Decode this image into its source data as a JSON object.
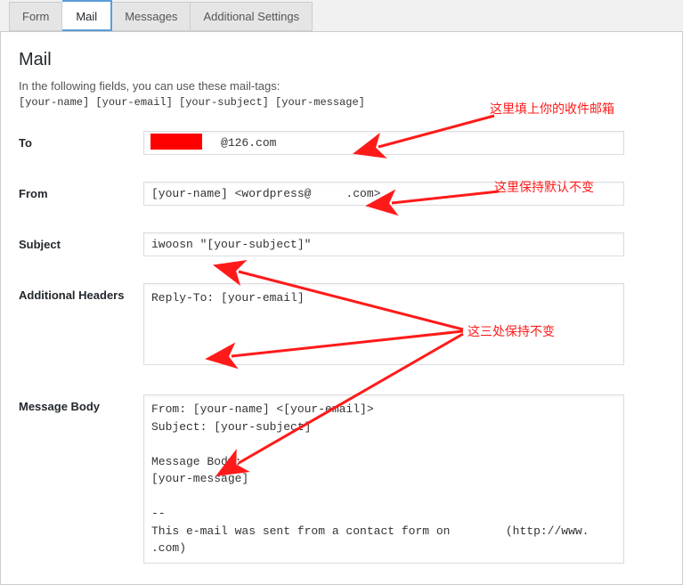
{
  "tabs": {
    "form": "Form",
    "mail": "Mail",
    "messages": "Messages",
    "additional": "Additional Settings"
  },
  "heading": "Mail",
  "intro": "In the following fields, you can use these mail-tags:",
  "mailtags": "[your-name] [your-email] [your-subject] [your-message]",
  "labels": {
    "to": "To",
    "from": "From",
    "subject": "Subject",
    "headers": "Additional Headers",
    "body": "Message Body"
  },
  "values": {
    "to": "          @126.com",
    "from": "[your-name] <wordpress@     .com>",
    "subject": "iwoosn \"[your-subject]\"",
    "headers": "Reply-To: [your-email]",
    "body": "From: [your-name] <[your-email]>\nSubject: [your-subject]\n\nMessage Body:\n[your-message]\n\n--\nThis e-mail was sent from a contact form on        (http://www.       .com)"
  },
  "annotations": {
    "a1": "这里填上你的收件邮箱",
    "a2": "这里保持默认不变",
    "a3": "这三处保持不变"
  }
}
